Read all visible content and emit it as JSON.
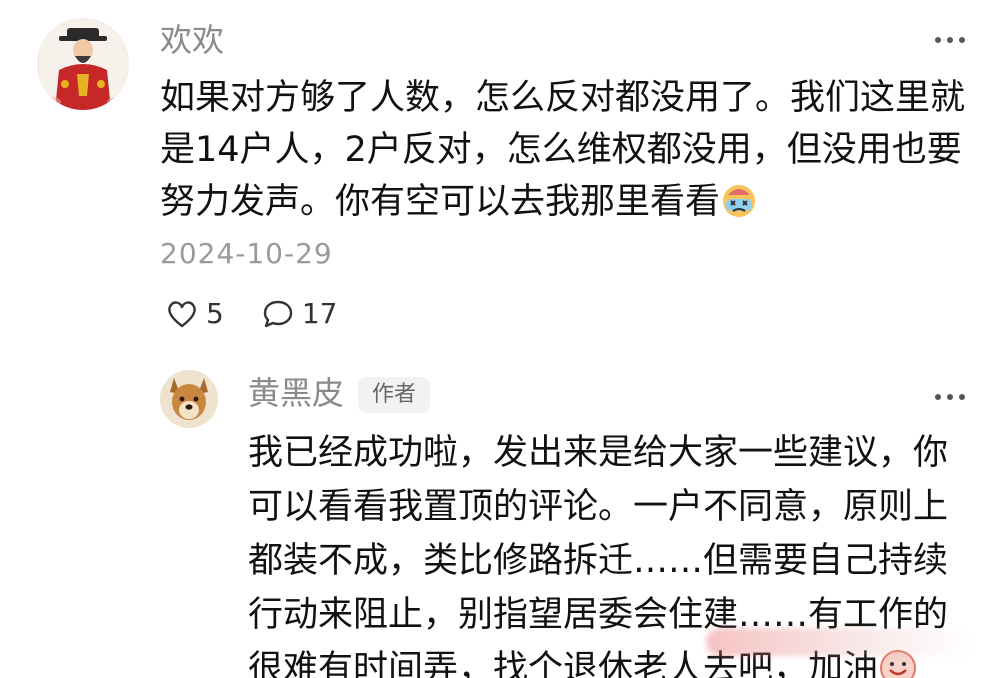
{
  "main_comment": {
    "username": "欢欢",
    "text": "如果对方够了人数，怎么反对都没用了。我们这里就是14户人，2户反对，怎么维权都没用，但没用也要努力发声。你有空可以去我那里看看",
    "emoji": "crying-emoji",
    "date": "2024-10-29",
    "likes": "5",
    "comments": "17"
  },
  "reply": {
    "username": "黄黑皮",
    "badge": "作者",
    "text": "我已经成功啦，发出来是给大家一些建议，你可以看看我置顶的评论。一户不同意，原则上都装不成，类比修路拆迁……但需要自己持续行动来阻止，别指望居委会住建……有工作的很难有时间弄，找个退休老人去吧，加油",
    "emoji": "cheer-emoji"
  },
  "icons": {
    "like": "heart-icon",
    "comment": "speech-bubble-icon",
    "more": "more-dots-icon"
  },
  "colors": {
    "text_primary": "#111111",
    "text_secondary": "#8a8a8a",
    "badge_bg": "#f2f2f2"
  }
}
